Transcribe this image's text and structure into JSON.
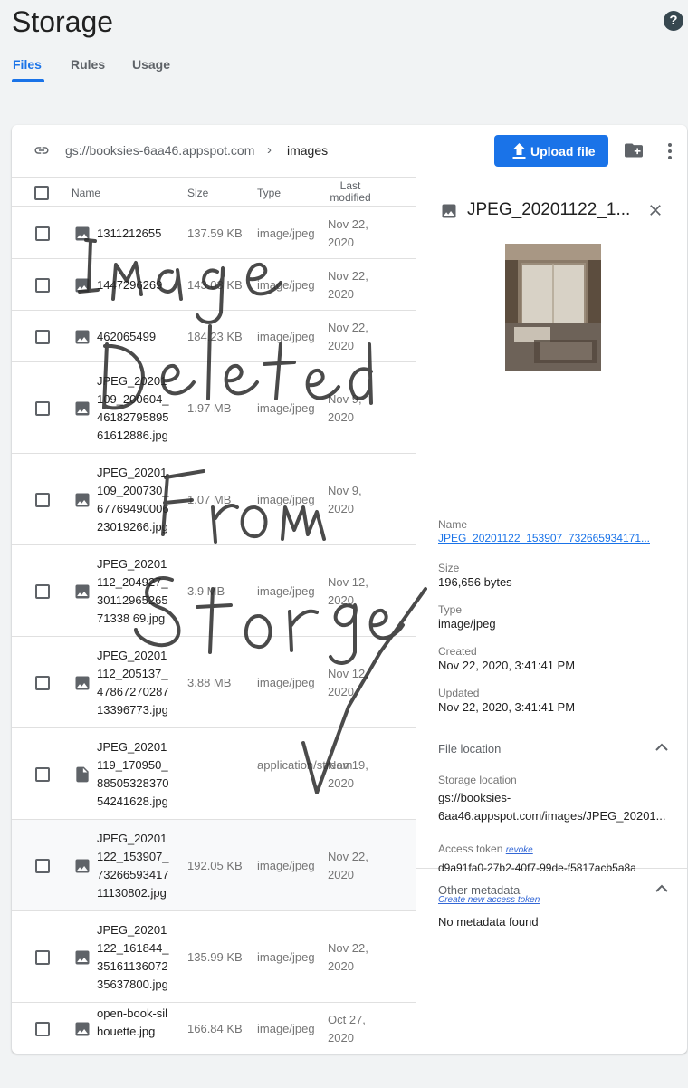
{
  "page": {
    "title": "Storage",
    "help_icon": "help-circle-icon"
  },
  "tabs": [
    {
      "label": "Files",
      "active": true
    },
    {
      "label": "Rules",
      "active": false
    },
    {
      "label": "Usage",
      "active": false
    }
  ],
  "toolbar": {
    "bucket_path": "gs://booksies-6aa46.appspot.com",
    "folder": "images",
    "upload_label": "Upload file"
  },
  "table": {
    "headers": {
      "name": "Name",
      "size": "Size",
      "type": "Type",
      "modified": "Last modified"
    },
    "rows": [
      {
        "name": "1311212655",
        "size": "137.59 KB",
        "type": "image/jpeg",
        "modified": "Nov 22, 2020",
        "icon": "image-icon"
      },
      {
        "name": "1447296269",
        "size": "143.03 KB",
        "type": "image/jpeg",
        "modified": "Nov 22, 2020",
        "icon": "image-icon"
      },
      {
        "name": "462065499",
        "size": "184.23 KB",
        "type": "image/jpeg",
        "modified": "Nov 22, 2020",
        "icon": "image-icon"
      },
      {
        "name": "JPEG_20201109_200604_4618279589561612886.jpg",
        "size": "1.97 MB",
        "type": "image/jpeg",
        "modified": "Nov 9, 2020",
        "icon": "image-icon"
      },
      {
        "name": "JPEG_20201109_200730_6776949000623019266.jpg",
        "size": "1.07 MB",
        "type": "image/jpeg",
        "modified": "Nov 9, 2020",
        "icon": "image-icon"
      },
      {
        "name": "JPEG_20201112_204927_3011296526571338 69.jpg",
        "size": "3.9 MB",
        "type": "image/jpeg",
        "modified": "Nov 12, 2020",
        "icon": "image-icon"
      },
      {
        "name": "JPEG_20201112_205137_4786727028713396773.jpg",
        "size": "3.88 MB",
        "type": "image/jpeg",
        "modified": "Nov 12, 2020",
        "icon": "image-icon"
      },
      {
        "name": "JPEG_20201119_170950_8850532837054241628.jpg",
        "size": "—",
        "type": "application/stream",
        "modified": "Nov 19, 2020",
        "icon": "file-icon"
      },
      {
        "name": "JPEG_20201122_153907_7326659341711130802.jpg",
        "size": "192.05 KB",
        "type": "image/jpeg",
        "modified": "Nov 22, 2020",
        "icon": "image-icon",
        "selected": true
      },
      {
        "name": "JPEG_20201122_161844_3516113607235637800.jpg",
        "size": "135.99 KB",
        "type": "image/jpeg",
        "modified": "Nov 22, 2020",
        "icon": "image-icon"
      },
      {
        "name": "open-book-silhouette.jpg",
        "size": "166.84 KB",
        "type": "image/jpeg",
        "modified": "Oct 27, 2020",
        "icon": "image-icon"
      }
    ]
  },
  "detail": {
    "title": "JPEG_20201122_1...",
    "name_label": "Name",
    "name_value": "JPEG_20201122_153907_732665934171...",
    "size_label": "Size",
    "size_value": "196,656 bytes",
    "type_label": "Type",
    "type_value": "image/jpeg",
    "created_label": "Created",
    "created_value": "Nov 22, 2020, 3:41:41 PM",
    "updated_label": "Updated",
    "updated_value": "Nov 22, 2020, 3:41:41 PM",
    "file_location": {
      "title": "File location",
      "storage_label": "Storage location",
      "storage_line1": "gs://booksies-",
      "storage_line2": "6aa46.appspot.com/images/JPEG_20201...",
      "token_label": "Access token",
      "revoke_label": "revoke",
      "token_value": "d9a91fa0-27b2-40f7-99de-f5817acb5a8a",
      "create_token_label": "Create new access token"
    },
    "other_metadata": {
      "title": "Other metadata",
      "value": "No metadata found"
    }
  },
  "annotation": {
    "text_lines": [
      "Image",
      "Deleted",
      "From",
      "Storage"
    ],
    "mark": "checkmark"
  }
}
